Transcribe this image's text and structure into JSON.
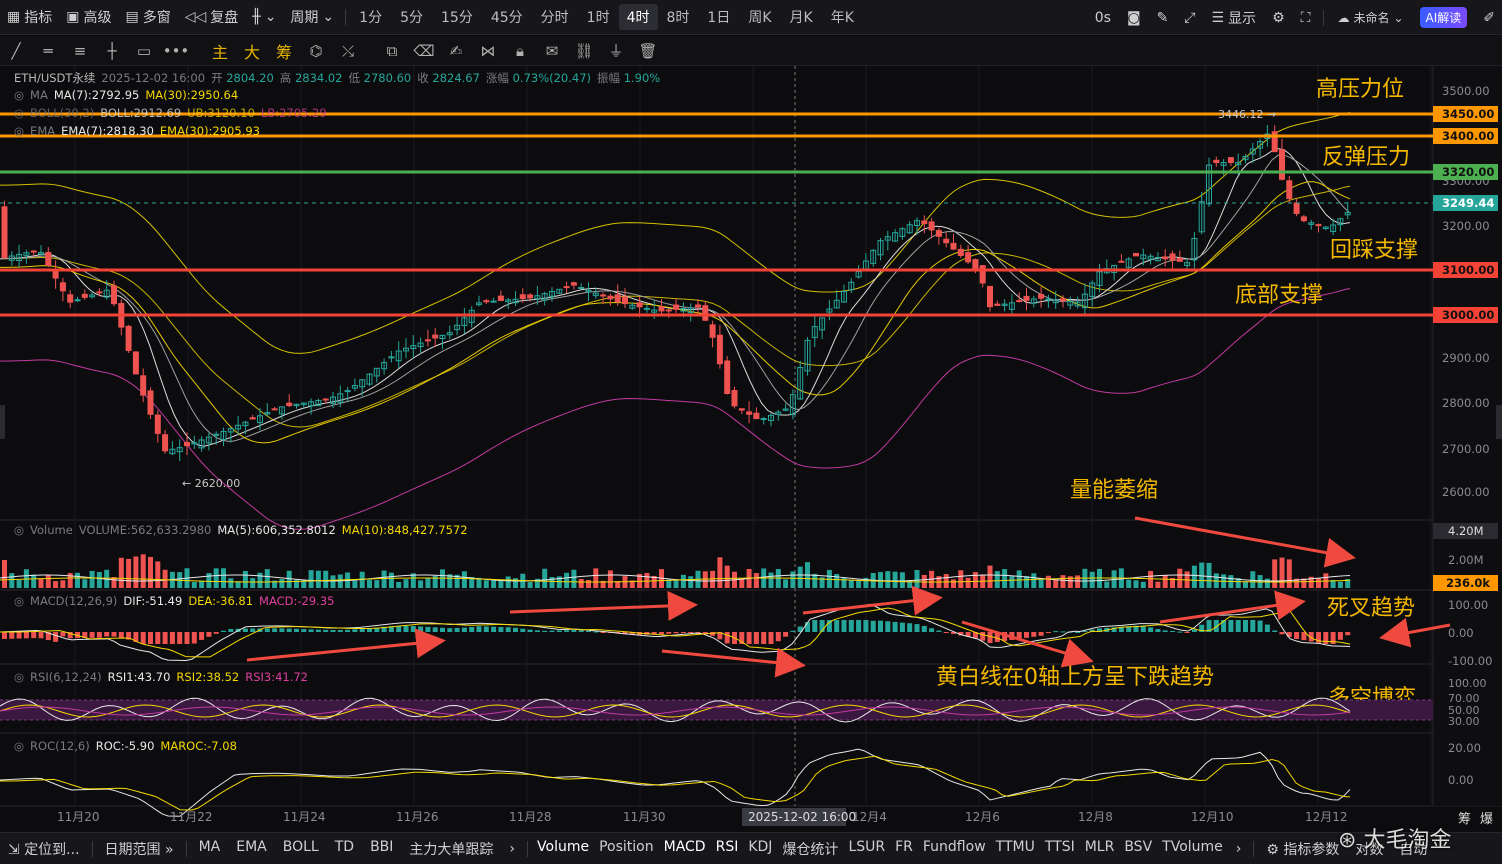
{
  "topbar": {
    "indicators": "指标",
    "advanced": "高级",
    "multi_window": "多窗",
    "replay": "复盘",
    "period": "周期",
    "timeframes": [
      "1分",
      "5分",
      "15分",
      "45分",
      "分时",
      "1时",
      "4时",
      "8时",
      "1日",
      "周K",
      "月K",
      "年K"
    ],
    "active_timeframe": "4时",
    "seconds": "0s",
    "display": "显示",
    "unnamed": "未命名",
    "ai": "AI解读"
  },
  "toolbar": {
    "main": "主",
    "big": "大",
    "chip": "筹"
  },
  "legend": {
    "symbol": "ETH/USDT永续",
    "datetime": "2025-12-02 16:00",
    "open_label": "开",
    "open": "2804.20",
    "high_label": "高",
    "high": "2834.02",
    "low_label": "低",
    "low": "2780.60",
    "close_label": "收",
    "close": "2824.67",
    "chg_label": "涨幅",
    "chg": "0.73%(20.47)",
    "amp_label": "振幅",
    "amp": "1.90%",
    "ma_name": "MA",
    "ma7": "MA(7):2792.95",
    "ma30": "MA(30):2950.64",
    "boll_name": "BOLL(30,2)",
    "boll": "BOLL:2912.69",
    "boll_ub": "UB:3120.10",
    "boll_lb": "LB:2705.29",
    "ema_name": "EMA",
    "ema7": "EMA(7):2818.30",
    "ema30": "EMA(30):2905.93",
    "vol_name": "Volume",
    "vol": "VOLUME:562,633.2980",
    "vol_ma5": "MA(5):606,352.8012",
    "vol_ma10": "MA(10):848,427.7572",
    "macd_name": "MACD(12,26,9)",
    "dif": "DIF:-51.49",
    "dea": "DEA:-36.81",
    "macd": "MACD:-29.35",
    "rsi_name": "RSI(6,12,24)",
    "rsi1": "RSI1:43.70",
    "rsi2": "RSI2:38.52",
    "rsi3": "RSI3:41.72",
    "roc_name": "ROC(12,6)",
    "roc": "ROC:-5.90",
    "maroc": "MAROC:-7.08"
  },
  "price_axis": {
    "ticks": [
      "3500.00",
      "3300.00",
      "3200.00",
      "2900.00",
      "2800.00",
      "2700.00",
      "2600.00"
    ],
    "tag_3450": "3450.00",
    "tag_3400": "3400.00",
    "tag_3320": "3320.00",
    "tag_last": "3249.44",
    "tag_3100": "3100.00",
    "tag_3000": "3000.00"
  },
  "annotations": {
    "high_pressure": "高压力位",
    "rebound_pressure": "反弹压力",
    "pullback_support": "回踩支撑",
    "bottom_support": "底部支撑",
    "volume_shrink": "量能萎缩",
    "death_cross": "死叉趋势",
    "yellow_white": "黄白线在0轴上方呈下跌趋势",
    "bull_bear": "多空博弈",
    "max_marker": "3446.12",
    "min_marker": "2620.00"
  },
  "volume_axis": {
    "top": "4.20M",
    "mid": "2.00M",
    "cur": "236.0k"
  },
  "macd_axis": [
    "100.00",
    "0.00",
    "-100.00"
  ],
  "rsi_axis": [
    "100.00",
    "70.00",
    "50.00",
    "30.00"
  ],
  "roc_axis": [
    "20.00",
    "0.00"
  ],
  "time_axis": {
    "labels": [
      "11月20",
      "11月22",
      "11月24",
      "11月26",
      "11月28",
      "11月30",
      "12月4",
      "12月6",
      "12月8",
      "12月10",
      "12月12"
    ],
    "crosshair": "2025-12-02 16:00",
    "right_a": "筹",
    "right_b": "爆"
  },
  "bottombar": {
    "locate": "定位到...",
    "date_range": "日期范围",
    "main_inds": [
      "MA",
      "EMA",
      "BOLL",
      "TD",
      "BBI",
      "主力大单跟踪"
    ],
    "sub_inds": [
      "Volume",
      "Position",
      "MACD",
      "RSI",
      "KDJ",
      "爆仓统计",
      "LSUR",
      "FR",
      "Fundflow",
      "TTMU",
      "TTSI",
      "MLR",
      "BSV",
      "TVolume"
    ],
    "config": "指标参数",
    "log": "对数",
    "auto": "自动",
    "watermark": "大毛淘金"
  },
  "colors": {
    "up": "#ef5350",
    "down": "#26a69a",
    "accent_orange": "#ff9800",
    "accent_green": "#4caf50",
    "accent_red": "#f44336",
    "annotation": "#f5b800"
  }
}
